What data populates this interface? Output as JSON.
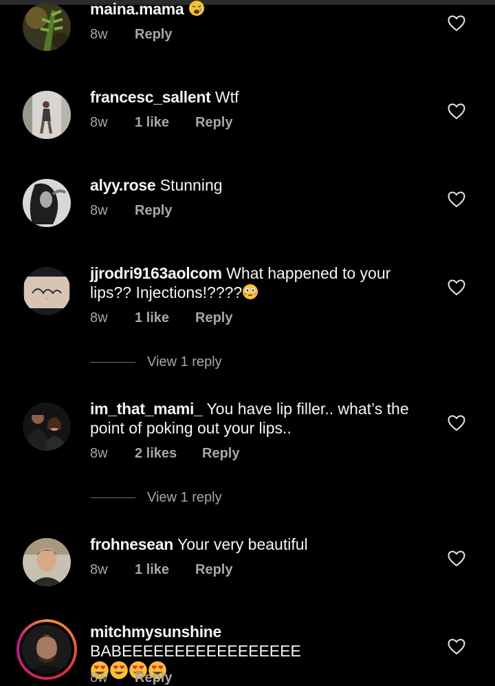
{
  "comments": [
    {
      "username": "maina.mama",
      "text": "",
      "emoji": "weary-face",
      "time": "8w",
      "likes": "",
      "reply": "Reply"
    },
    {
      "username": "francesc_sallent",
      "text": "Wtf",
      "time": "8w",
      "likes": "1 like",
      "reply": "Reply"
    },
    {
      "username": "alyy.rose",
      "text": "Stunning",
      "time": "8w",
      "likes": "",
      "reply": "Reply"
    },
    {
      "username": "jjrodri9163aolcom",
      "text": "What happened to your lips?? Injections!????",
      "emoji": "flushed-face",
      "time": "8w",
      "likes": "1 like",
      "reply": "Reply",
      "view_replies": "View 1 reply"
    },
    {
      "username": "im_that_mami_",
      "text": "You have lip filler.. what’s the point of poking out your lips..",
      "time": "8w",
      "likes": "2 likes",
      "reply": "Reply",
      "view_replies": "View 1 reply"
    },
    {
      "username": "frohnesean",
      "text": "Your very beautiful",
      "time": "8w",
      "likes": "1 like",
      "reply": "Reply"
    },
    {
      "username": "mitchmysunshine",
      "text": "BABEEEEEEEEEEEEEEEEE",
      "emoji": "heart-eyes-face x4",
      "time": "8w",
      "likes": "",
      "reply": "Reply",
      "story_ring": true
    }
  ],
  "colors": {
    "background": "#000000",
    "secondary_text": "#a8a8a8",
    "primary_text": "#f5f5f5"
  }
}
